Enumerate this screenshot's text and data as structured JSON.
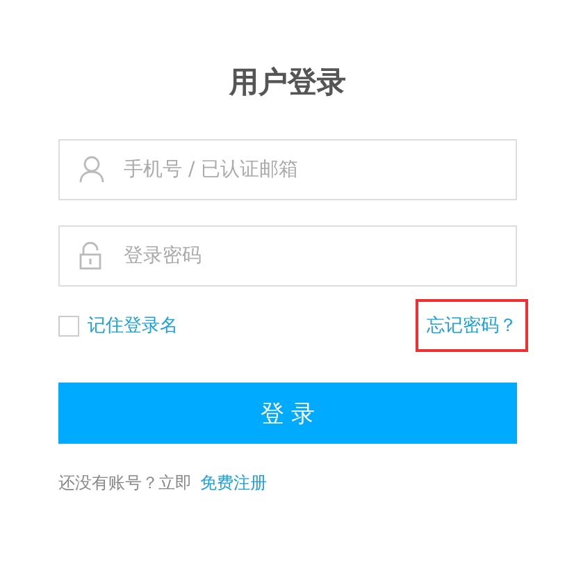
{
  "title": "用户登录",
  "fields": [
    {
      "kind": "user",
      "placeholder": "手机号 / 已认证邮箱"
    },
    {
      "kind": "password",
      "placeholder": "登录密码"
    }
  ],
  "remember": {
    "label": "记住登录名",
    "checked": false
  },
  "forgot": {
    "label": "忘记密码？",
    "highlighted": true
  },
  "submit": "登 录",
  "signup": {
    "text": "还没有账号？立即",
    "link": "免费注册"
  }
}
